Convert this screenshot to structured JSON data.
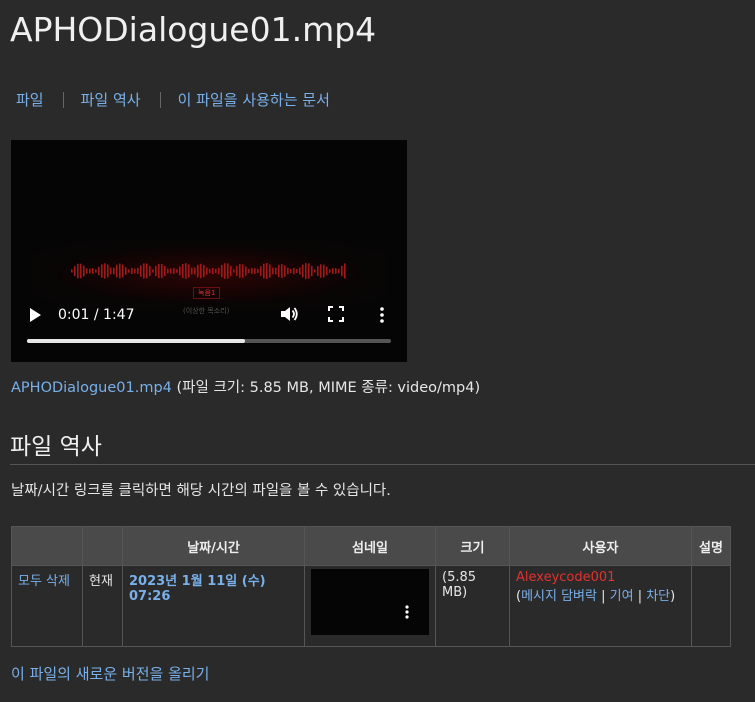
{
  "page": {
    "title": "APHODialogue01.mp4"
  },
  "tabs": [
    "파일",
    "파일 역사",
    "이 파일을 사용하는 문서"
  ],
  "player": {
    "current_time": "0:01",
    "duration": "1:47",
    "time_display": "0:01 / 1:47",
    "progress": 0.6,
    "subtitle_tag": "녹음1",
    "subtitle_text": "(이상한 목소리)"
  },
  "file_info": {
    "link": "APHODialogue01.mp4",
    "details": " (파일 크기: 5.85 MB, MIME 종류: video/mp4)"
  },
  "history": {
    "heading": "파일 역사",
    "description": "날짜/시간 링크를 클릭하면 해당 시간의 파일을 볼 수 있습니다.",
    "headers": {
      "date": "날짜/시간",
      "thumb": "섬네일",
      "size": "크기",
      "user": "사용자",
      "desc": "설명"
    },
    "row": {
      "delete_all": "모두 삭제",
      "current": "현재",
      "date": "2023년 1월 11일 (수) 07:26",
      "size": "(5.85 MB)",
      "user": "Alexeycode001",
      "talk": "메시지 담벼락",
      "contribs": "기여",
      "block": "차단"
    }
  },
  "upload_link": "이 파일의 새로운 버전을 올리기",
  "colors": {
    "link": "#79b0ea",
    "user": "#e53030",
    "background": "#2a2a2a"
  }
}
